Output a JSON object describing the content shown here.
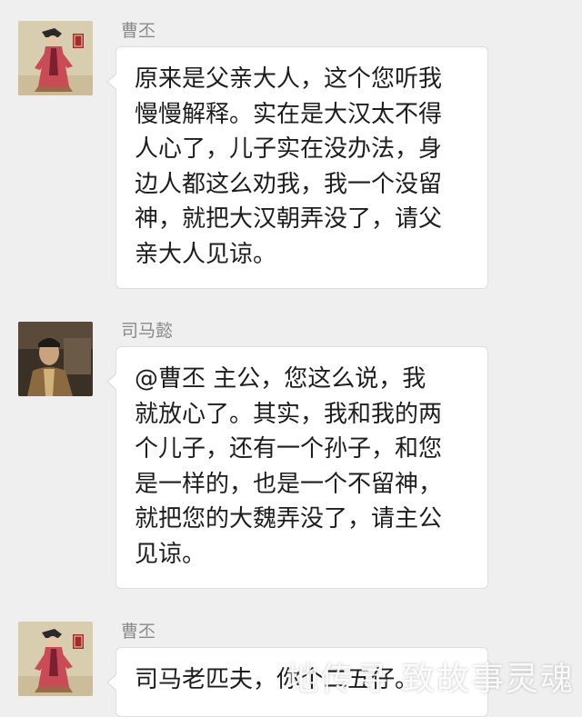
{
  "colors": {
    "background": "#efefef",
    "bubble": "#ffffff",
    "name": "#8a8a8a",
    "text": "#1d1d1d"
  },
  "messages": [
    {
      "sender": "曹丕",
      "avatar": "caopi-avatar",
      "lines": [
        "原来是父亲大人，这个您听我",
        "慢慢解释。实在是大汉太不得",
        "人心了，儿子实在没办法，身",
        "边人都这么劝我，我一个没留",
        "神，就把大汉朝弄没了，请父",
        "亲大人见谅。"
      ]
    },
    {
      "sender": "司马懿",
      "avatar": "simayi-avatar",
      "lines": [
        "@曹丕 主公，您这么说，我",
        "就放心了。其实，我和我的两",
        "个儿子，还有一个孙子，和您",
        "是一样的，也是一个不留神，",
        "就把您的大魏弄没了，请主公",
        "见谅。"
      ]
    },
    {
      "sender": "曹丕",
      "avatar": "caopi-avatar",
      "lines": [
        "司马老匹夫，你个二五仔。"
      ]
    }
  ],
  "watermark": "地传寻 致故事灵魂"
}
